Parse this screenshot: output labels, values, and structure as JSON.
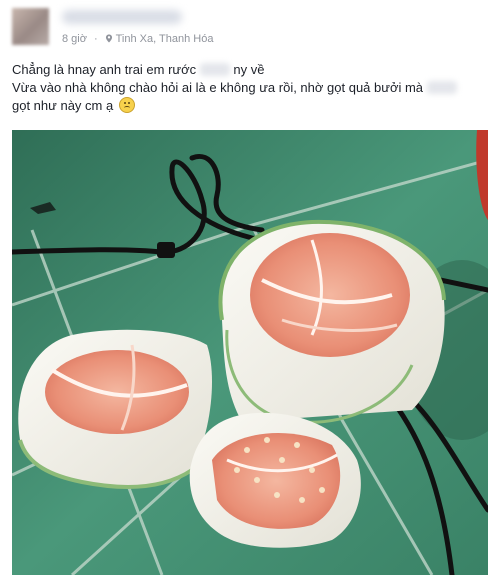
{
  "post": {
    "time": "8 giờ",
    "location": "Tinh Xa, Thanh Hóa",
    "line1_a": "Chẳng là hnay anh trai em rước",
    "line1_b": "ny về",
    "line2_a": "Vừa vào nhà không chào hỏi ai là e không ưa rồi, nhờ gọt quả bưởi mà",
    "line3_a": "gọt như này cm ạ",
    "emoji_name": "slightly-frowning-face-icon"
  },
  "colors": {
    "text": "#1d2129",
    "meta": "#90949c",
    "tile": "#3f8a6c",
    "pomelo_flesh": "#ec9f88",
    "pomelo_rind": "#f3f1ea"
  }
}
